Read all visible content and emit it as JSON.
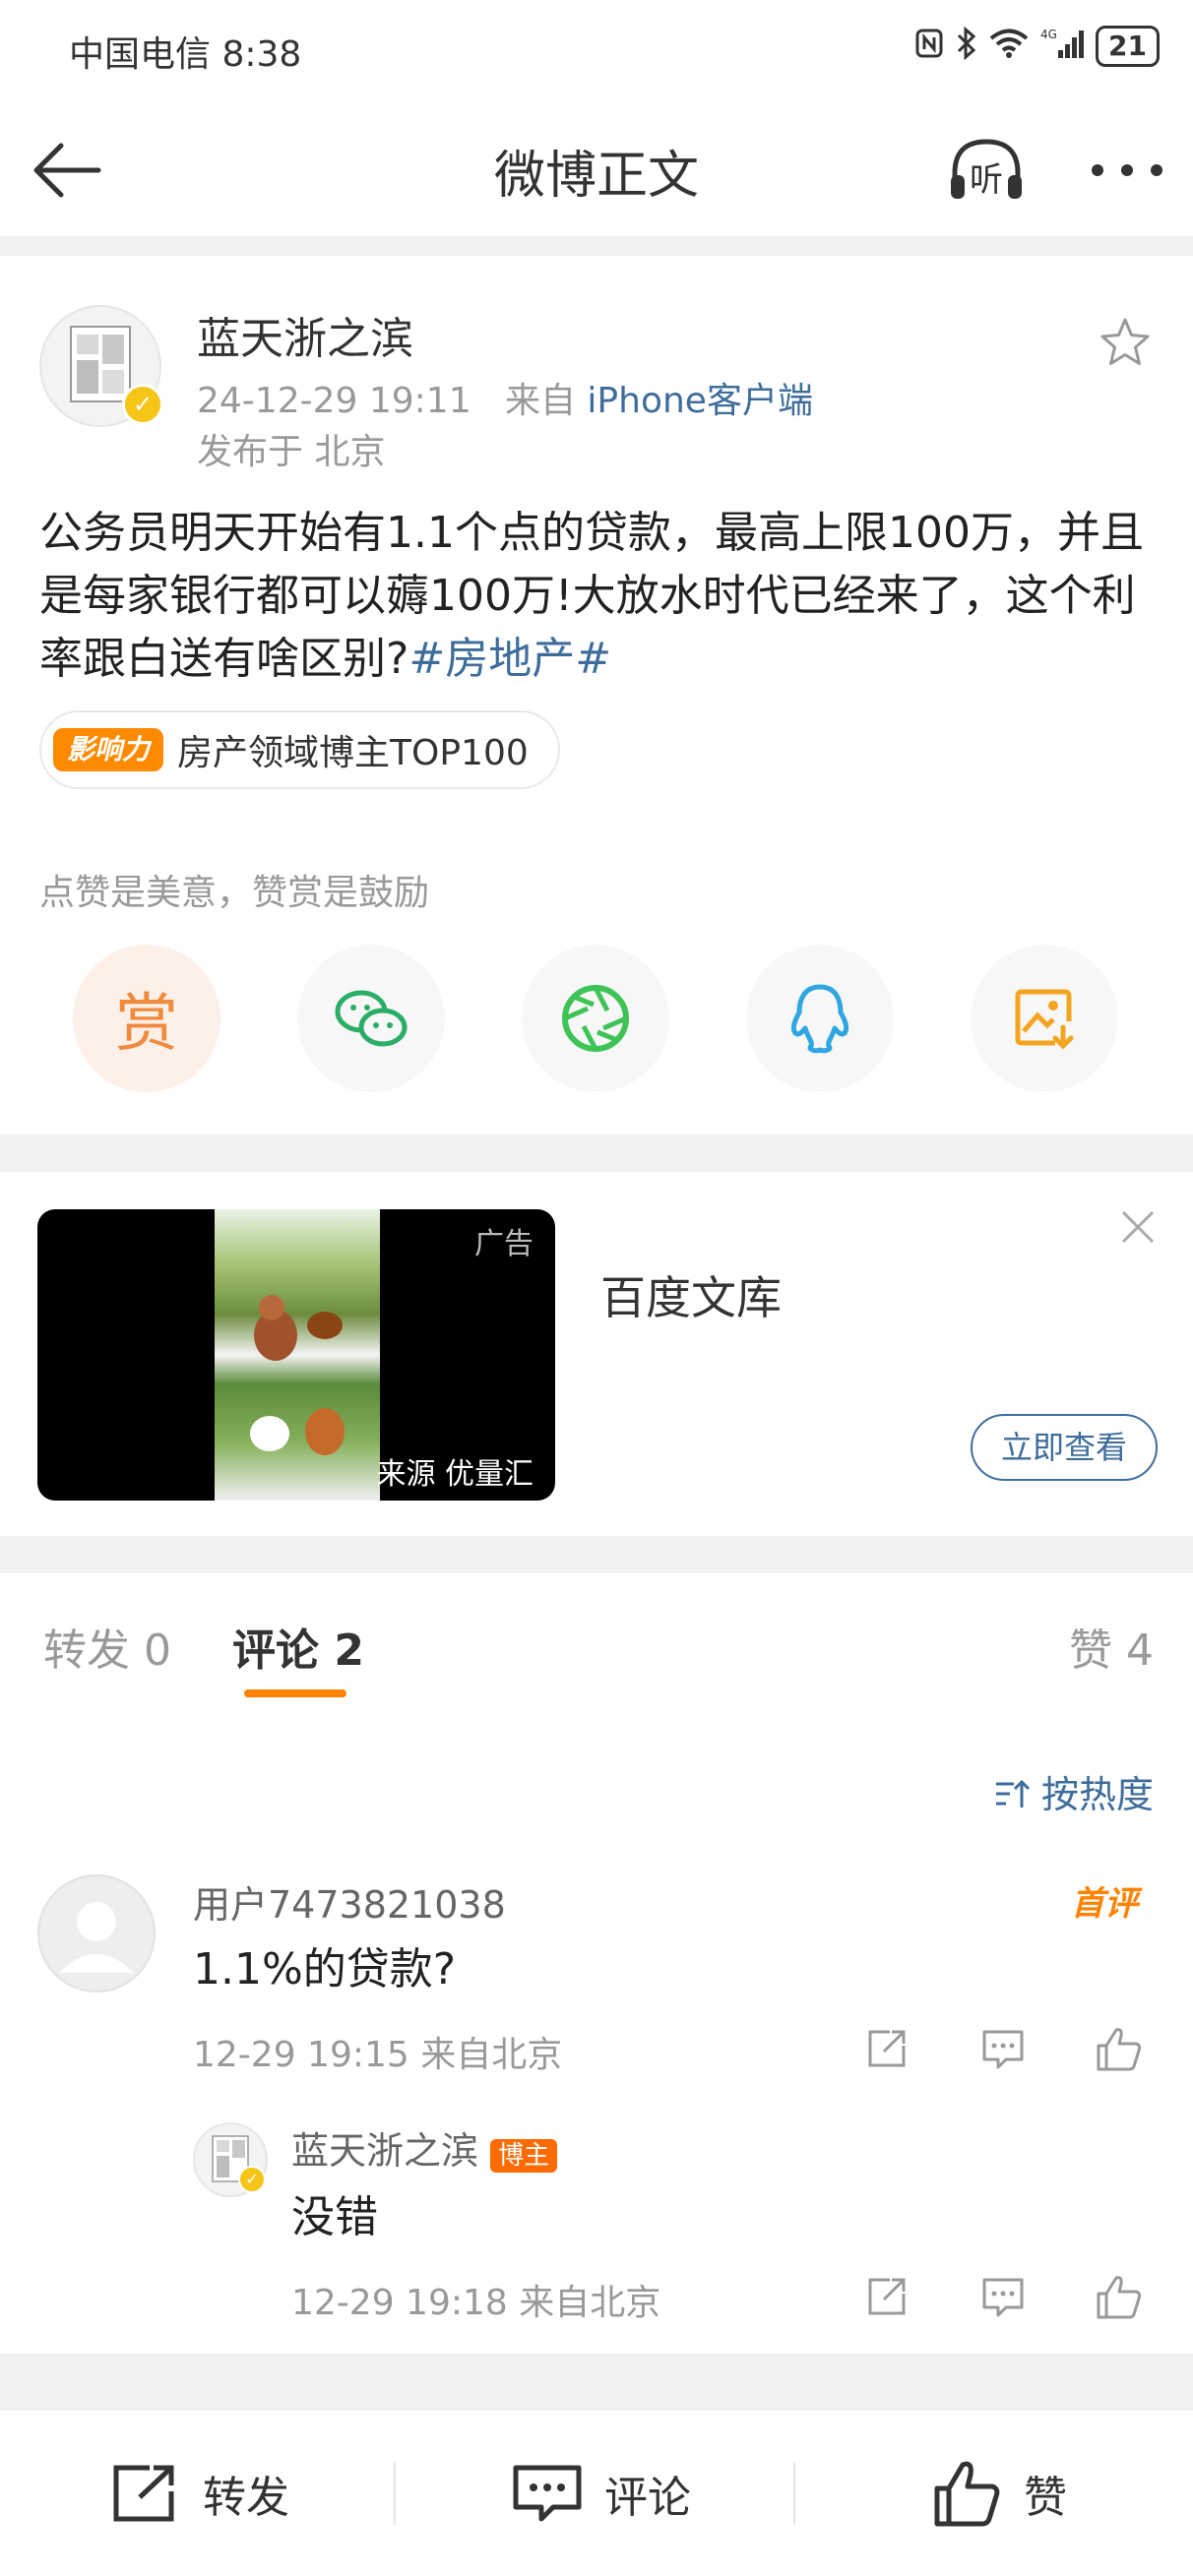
{
  "status_bar": {
    "carrier": "中国电信",
    "time": "8:38",
    "network": "4G",
    "battery": "21"
  },
  "nav": {
    "title": "微博正文",
    "listen_label": "听"
  },
  "post": {
    "author": "蓝天浙之滨",
    "timestamp": "24-12-29 19:11",
    "source_prefix": "来自",
    "source": "iPhone客户端",
    "location": "发布于 北京",
    "content": "公务员明天开始有1.1个点的贷款，最高上限100万，并且是每家银行都可以薅100万!大放水时代已经来了，这个利率跟白送有啥区别?",
    "topic": "#房地产#",
    "influence_badge_logo": "影响力",
    "influence_badge_text": "房产领域博主TOP100",
    "reward_tip": "点赞是美意，赞赏是鼓励",
    "reward_label": "赏"
  },
  "ad": {
    "label": "广告",
    "source": "来源 优量汇",
    "title": "百度文库",
    "cta": "立即查看"
  },
  "tabs": {
    "repost": "转发 0",
    "comment": "评论 2",
    "like": "赞 4"
  },
  "comments": {
    "sort_label": "按热度",
    "items": [
      {
        "user": "用户7473821038",
        "text": "1.1%的贷款?",
        "meta": "12-29 19:15 来自北京",
        "tag": "首评"
      }
    ],
    "reply": {
      "user": "蓝天浙之滨",
      "tag": "博主",
      "text": "没错",
      "meta": "12-29 19:18 来自北京"
    }
  },
  "bottom_bar": {
    "repost": "转发",
    "comment": "评论",
    "like": "赞"
  },
  "colors": {
    "link": "#3e6d9c",
    "accent": "#ff8200",
    "verify": "#f5c518"
  }
}
